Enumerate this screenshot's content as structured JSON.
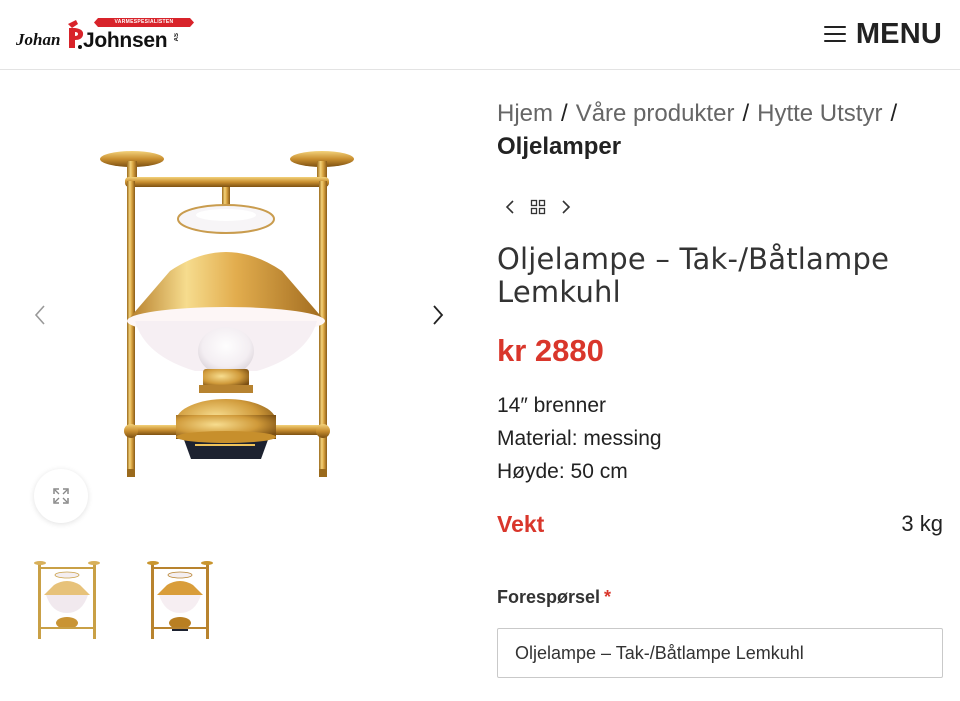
{
  "header": {
    "logo": {
      "banner_text": "VARMESPESIALISTEN",
      "first_name": "Johan",
      "initial": "P.",
      "last_name": "Johnsen",
      "suffix": "AS"
    },
    "menu_label": "MENU"
  },
  "gallery": {
    "main_image": "brass-oil-lamp-photo",
    "thumbnails": [
      "brass-oil-lamp-thumb-1",
      "brass-oil-lamp-thumb-2"
    ],
    "icons": {
      "prev": "chevron-left-icon",
      "next": "chevron-right-icon",
      "zoom": "expand-icon"
    }
  },
  "breadcrumb": {
    "items": [
      "Hjem",
      "Våre produkter",
      "Hytte Utstyr"
    ],
    "separator": "/",
    "current": "Oljelamper"
  },
  "product": {
    "title": "Oljelampe – Tak-/Båtlampe Lemkuhl",
    "price": "kr 2880",
    "description": [
      "14″ brenner",
      "Material: messing",
      "Høyde: 50 cm"
    ],
    "spec": {
      "label": "Vekt",
      "value": "3 kg"
    }
  },
  "form": {
    "label": "Forespørsel",
    "required_mark": "*",
    "value": "Oljelampe – Tak-/Båtlampe Lemkuhl"
  },
  "colors": {
    "accent_red": "#d9362b",
    "brass": "#d9a441",
    "text": "#222222"
  }
}
